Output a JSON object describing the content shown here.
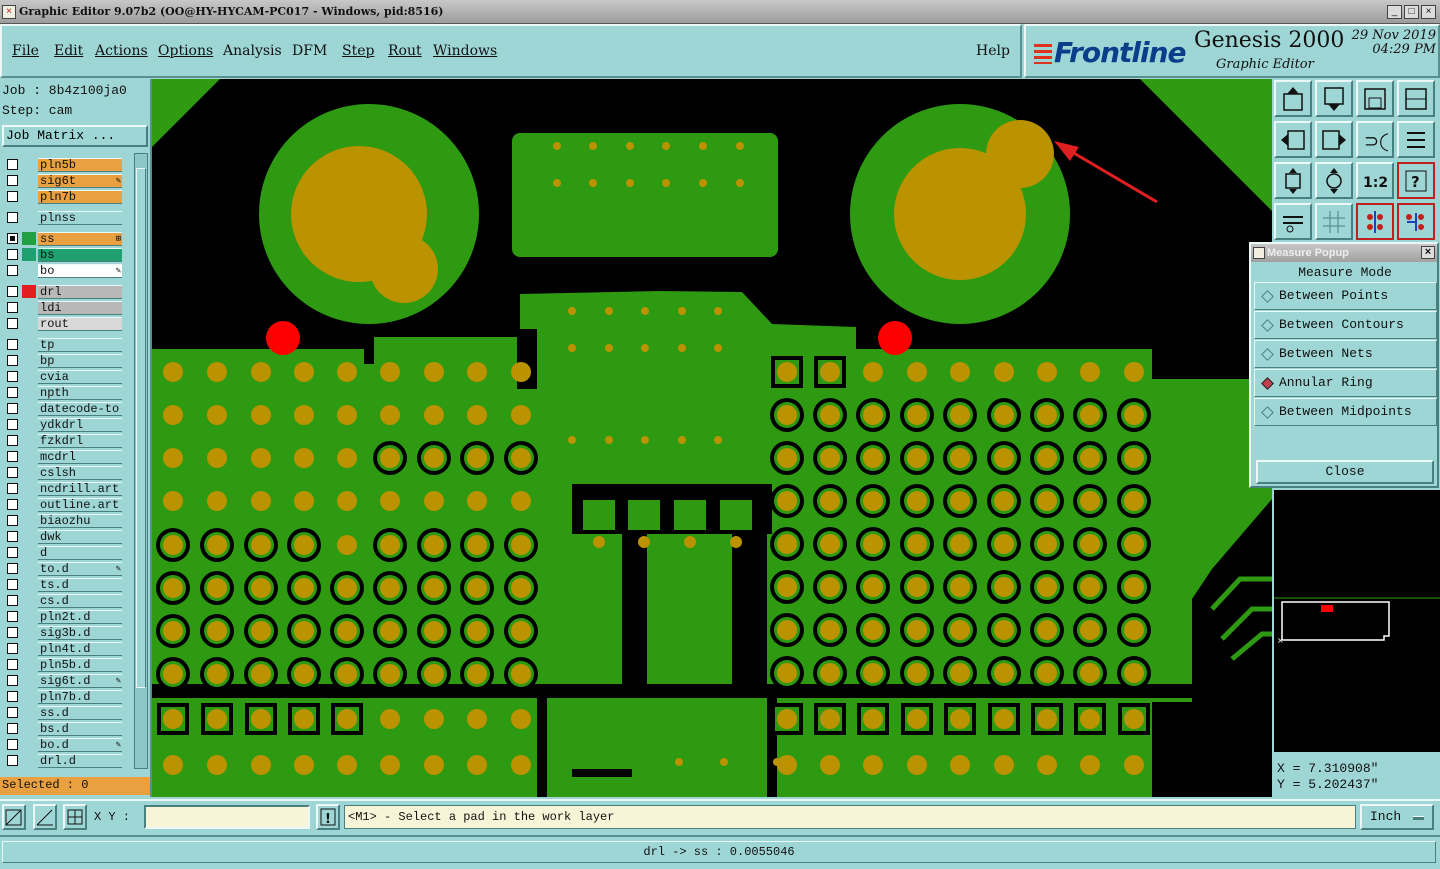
{
  "window": {
    "title": "Graphic Editor 9.07b2 (OO@HY-HYCAM-PC017 - Windows, pid:8516)",
    "buttons": [
      "_",
      "□",
      "×"
    ]
  },
  "menu": {
    "items": [
      "File",
      "Edit",
      "Actions",
      "Options",
      "Analysis",
      "DFM",
      "Step",
      "Rout",
      "Windows"
    ],
    "help": "Help"
  },
  "brand": {
    "logo": "Frontline",
    "product": "Genesis 2000",
    "subtitle": "Graphic Editor",
    "date": "29 Nov 2019",
    "time": "04:29 PM"
  },
  "left": {
    "job": "Job : 8b4z100ja0",
    "step": "Step: cam",
    "job_matrix": "Job Matrix ...",
    "selected": "Selected : 0",
    "layers": [
      {
        "name": "pln5b",
        "color": "#e8a040",
        "checked": false,
        "mark": ""
      },
      {
        "name": "sig6t",
        "color": "#e8a040",
        "checked": false,
        "mark": "✎"
      },
      {
        "name": "pln7b",
        "color": "#e8a040",
        "checked": false,
        "mark": ""
      },
      {
        "name": "plnss",
        "color": "#9ed6d6",
        "checked": false,
        "mark": ""
      },
      {
        "name": "ss",
        "color": "#e8a040",
        "checked": true,
        "mark": "⊞"
      },
      {
        "name": "bs",
        "color": "#20a070",
        "checked": false,
        "mark": ""
      },
      {
        "name": "bo",
        "color": "#ffffff",
        "checked": false,
        "mark": "✎"
      },
      {
        "name": "drl",
        "color": "#b8b8b8",
        "checked": false,
        "mark": ""
      },
      {
        "name": "ldi",
        "color": "#b8b8b8",
        "checked": false,
        "mark": ""
      },
      {
        "name": "rout",
        "color": "#d8d8d8",
        "checked": false,
        "mark": ""
      },
      {
        "name": "tp",
        "color": "#9ed6d6",
        "checked": false,
        "mark": ""
      },
      {
        "name": "bp",
        "color": "#9ed6d6",
        "checked": false,
        "mark": ""
      },
      {
        "name": "cvia",
        "color": "#9ed6d6",
        "checked": false,
        "mark": ""
      },
      {
        "name": "npth",
        "color": "#9ed6d6",
        "checked": false,
        "mark": ""
      },
      {
        "name": "datecode-to",
        "color": "#9ed6d6",
        "checked": false,
        "mark": ""
      },
      {
        "name": "ydkdrl",
        "color": "#9ed6d6",
        "checked": false,
        "mark": ""
      },
      {
        "name": "fzkdrl",
        "color": "#9ed6d6",
        "checked": false,
        "mark": ""
      },
      {
        "name": "mcdrl",
        "color": "#9ed6d6",
        "checked": false,
        "mark": ""
      },
      {
        "name": "cslsh",
        "color": "#9ed6d6",
        "checked": false,
        "mark": ""
      },
      {
        "name": "ncdrill.art",
        "color": "#9ed6d6",
        "checked": false,
        "mark": ""
      },
      {
        "name": "outline.art",
        "color": "#9ed6d6",
        "checked": false,
        "mark": ""
      },
      {
        "name": "biaozhu",
        "color": "#9ed6d6",
        "checked": false,
        "mark": ""
      },
      {
        "name": "dwk",
        "color": "#9ed6d6",
        "checked": false,
        "mark": ""
      },
      {
        "name": "d",
        "color": "#9ed6d6",
        "checked": false,
        "mark": ""
      },
      {
        "name": "to.d",
        "color": "#9ed6d6",
        "checked": false,
        "mark": "✎"
      },
      {
        "name": "ts.d",
        "color": "#9ed6d6",
        "checked": false,
        "mark": ""
      },
      {
        "name": "cs.d",
        "color": "#9ed6d6",
        "checked": false,
        "mark": ""
      },
      {
        "name": "pln2t.d",
        "color": "#9ed6d6",
        "checked": false,
        "mark": ""
      },
      {
        "name": "sig3b.d",
        "color": "#9ed6d6",
        "checked": false,
        "mark": ""
      },
      {
        "name": "pln4t.d",
        "color": "#9ed6d6",
        "checked": false,
        "mark": ""
      },
      {
        "name": "pln5b.d",
        "color": "#9ed6d6",
        "checked": false,
        "mark": ""
      },
      {
        "name": "sig6t.d",
        "color": "#9ed6d6",
        "checked": false,
        "mark": "✎"
      },
      {
        "name": "pln7b.d",
        "color": "#9ed6d6",
        "checked": false,
        "mark": ""
      },
      {
        "name": "ss.d",
        "color": "#9ed6d6",
        "checked": false,
        "mark": ""
      },
      {
        "name": "bs.d",
        "color": "#9ed6d6",
        "checked": false,
        "mark": ""
      },
      {
        "name": "bo.d",
        "color": "#9ed6d6",
        "checked": false,
        "mark": "✎"
      },
      {
        "name": "drl.d",
        "color": "#9ed6d6",
        "checked": false,
        "mark": ""
      }
    ],
    "swatches": {
      "ss": "#20a040",
      "bs": "#20a070",
      "drl": "#e02020"
    }
  },
  "measure": {
    "title": "Measure Popup",
    "heading": "Measure Mode",
    "options": [
      "Between Points",
      "Between Contours",
      "Between Nets",
      "Annular Ring",
      "Between Midpoints"
    ],
    "selected": "Annular Ring",
    "close": "Close"
  },
  "coords": {
    "x": "X = 7.310908\"",
    "y": "Y = 5.202437\""
  },
  "bottom": {
    "xy_label": "X Y :",
    "xy_value": "",
    "prompt": "<M1> - Select a pad in the work layer",
    "units": "Inch"
  },
  "status": "drl -> ss : 0.0055046",
  "colors": {
    "copper": "#2e9a12",
    "pad": "#bb9200",
    "drill": "#ff0000",
    "background": "#000000",
    "arrow": "#e02020"
  }
}
